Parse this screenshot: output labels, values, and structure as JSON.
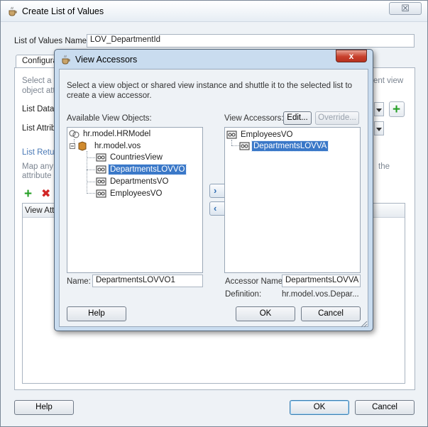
{
  "outer_dialog": {
    "title": "Create List of Values",
    "close_symbol": "☒",
    "lov_name_label": "List of Values Name:",
    "lov_name_value": "LOV_DepartmentId",
    "tab_label": "Configura",
    "select_text_line1": "Select a v",
    "select_text_line2": "object att",
    "select_text_right": "ent view",
    "list_data_label": "List Data",
    "list_attr_label": "List Attrib",
    "list_return_label": "List Retur",
    "map_text_line1": "Map any s",
    "map_text_line2": "attribute",
    "map_text_right": "the",
    "table_head_label": "View Attri",
    "help_label": "Help",
    "ok_label": "OK",
    "cancel_label": "Cancel",
    "icons": {
      "title_icon": "coffee-cup-icon",
      "add_icon": "green-plus-icon",
      "delete_icon": "red-x-icon"
    }
  },
  "inner_dialog": {
    "title": "View Accessors",
    "close_symbol": "x",
    "instruction_line1": "Select a view object or shared view instance and shuttle it to the selected list to",
    "instruction_line2": "create a view accessor.",
    "available_label": "Available View Objects:",
    "available_tree": {
      "root": "hr.model.HRModel",
      "package": "hr.model.vos",
      "items": [
        "CountriesView",
        "DepartmentsLOVVO",
        "DepartmentsVO",
        "EmployeesVO"
      ],
      "selected": "DepartmentsLOVVO"
    },
    "accessors_label": "View Accessors:",
    "edit_label": "Edit...",
    "override_label": "Override...",
    "accessors_tree": {
      "root": "EmployeesVO",
      "child": "DepartmentsLOVVA"
    },
    "name_label": "Name:",
    "name_value": "DepartmentsLOVVO1",
    "accessor_name_label": "Accessor Name:",
    "accessor_name_value": "DepartmentsLOVVA",
    "definition_label": "Definition:",
    "definition_value": "hr.model.vos.Depar...",
    "help_label": "Help",
    "ok_label": "OK",
    "cancel_label": "Cancel",
    "shuttle_right": "›",
    "shuttle_left": "‹",
    "colors": {
      "selection": "#3a78c8",
      "title_bar": "#c9dcef",
      "close_red": "#c7402c"
    }
  }
}
